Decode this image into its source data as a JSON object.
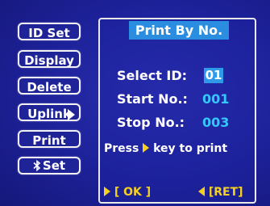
{
  "menu": {
    "items": [
      {
        "label": "ID Set"
      },
      {
        "label": "Display"
      },
      {
        "label": "Delete"
      },
      {
        "label": "Uplink"
      },
      {
        "label": "Print"
      },
      {
        "label": "Set"
      }
    ]
  },
  "panel": {
    "title": "Print By No.",
    "select_id_label": "Select ID:",
    "select_id_value": "01",
    "start_label": "Start  No.:",
    "start_value": "001",
    "stop_label": "Stop   No.:",
    "stop_value": "003",
    "hint_prefix": "Press",
    "hint_suffix": "key to print",
    "ok_label": "[ OK ]",
    "ret_label": "[RET]"
  },
  "colors": {
    "background": "#1b1f8c",
    "title_bg": "#2a8de0",
    "value": "#34c8ff",
    "softkey": "#f5d020"
  }
}
